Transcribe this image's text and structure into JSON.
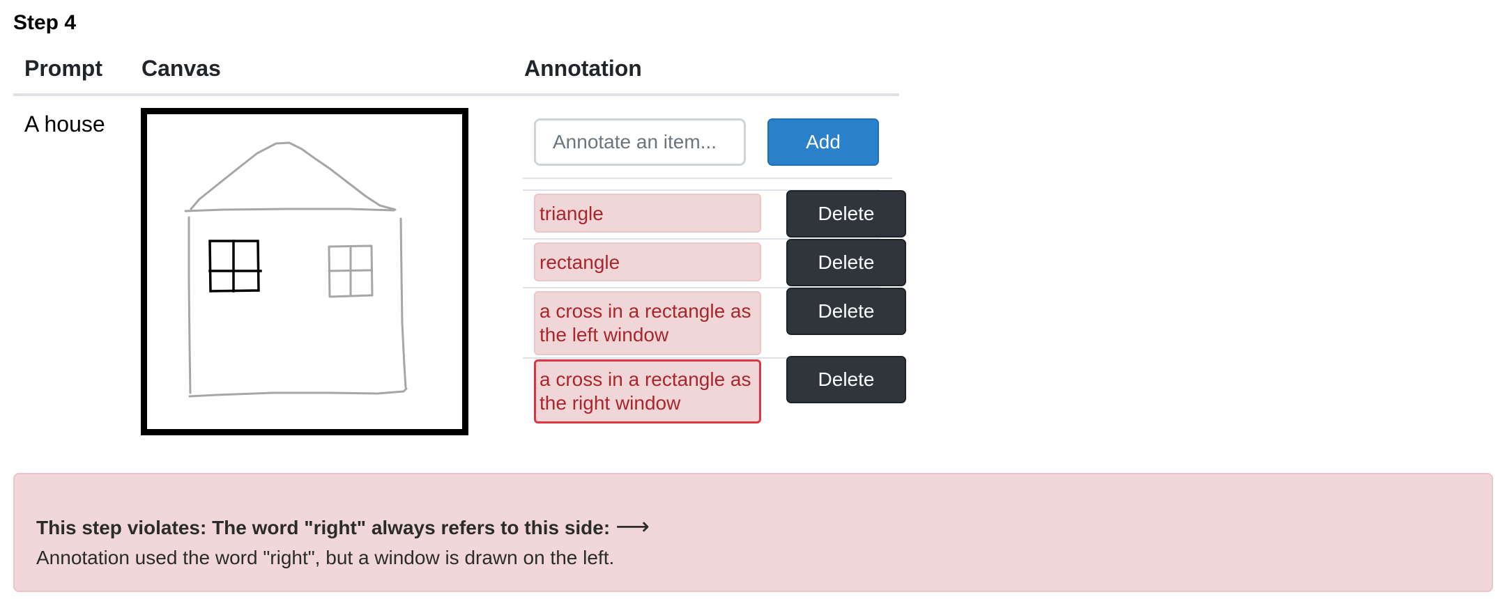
{
  "step": {
    "title": "Step 4"
  },
  "table": {
    "headers": {
      "prompt": "Prompt",
      "canvas": "Canvas",
      "annotation": "Annotation"
    }
  },
  "prompt": {
    "text": "A house"
  },
  "annotation": {
    "input_placeholder": "Annotate an item...",
    "input_value": "",
    "add_label": "Add",
    "items": [
      {
        "label": "triangle",
        "delete_label": "Delete"
      },
      {
        "label": "rectangle",
        "delete_label": "Delete"
      },
      {
        "label": "a cross in a rectangle as the left window",
        "delete_label": "Delete"
      },
      {
        "label": "a cross in a rectangle as the right window",
        "delete_label": "Delete"
      }
    ]
  },
  "alert": {
    "title": "This step violates: The word \"right\" always refers to this side:",
    "arrow": "⟶",
    "message": "Annotation used the word \"right\", but a window is drawn on the left."
  },
  "colors": {
    "add_button": "#2a81ca",
    "delete_button": "#2f353b",
    "annotation_bg": "#f1d6d8",
    "annotation_text": "#a9262d",
    "annotation_active_border": "#dc3545",
    "alert_bg": "#f1d7da",
    "sketch_stroke": "#a6a6a6",
    "highlight_stroke": "#000000"
  }
}
